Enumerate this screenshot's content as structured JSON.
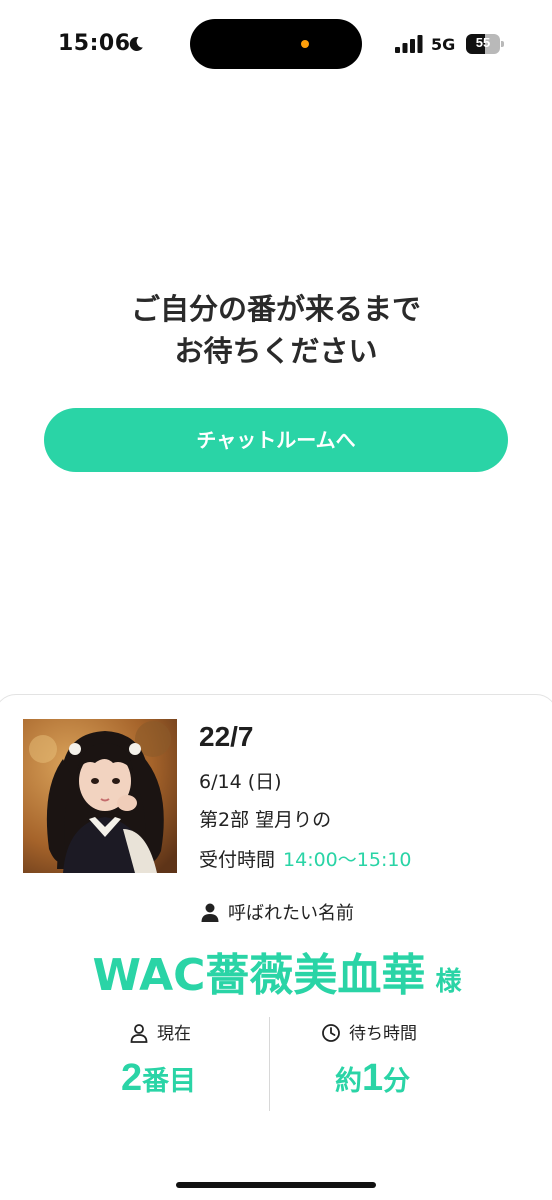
{
  "status_bar": {
    "time": "15:06",
    "network": "5G",
    "battery_level": 55,
    "battery_text": "55",
    "icons": [
      "moon-icon",
      "signal-icon",
      "battery-icon"
    ]
  },
  "wait": {
    "line1": "ご自分の番が来るまで",
    "line2": "お待ちください"
  },
  "chat_button_label": "チャットルームへ",
  "ticket": {
    "event_title": "22/7",
    "date": "6/14 (日)",
    "part": "第2部 望月りの",
    "reception_label": "受付時間",
    "reception_time": "14:00〜15:10",
    "name_label": "呼ばれたい名前",
    "called_name": "WAC薔薇美血華",
    "honorific": "様",
    "current_label": "現在",
    "current_number": "2",
    "current_unit": "番目",
    "wait_label": "待ち時間",
    "wait_prefix": "約",
    "wait_number": "1",
    "wait_unit": "分"
  },
  "colors": {
    "accent": "#2ad4a6",
    "text": "#222222",
    "island_dot": "#ff9f0a"
  }
}
